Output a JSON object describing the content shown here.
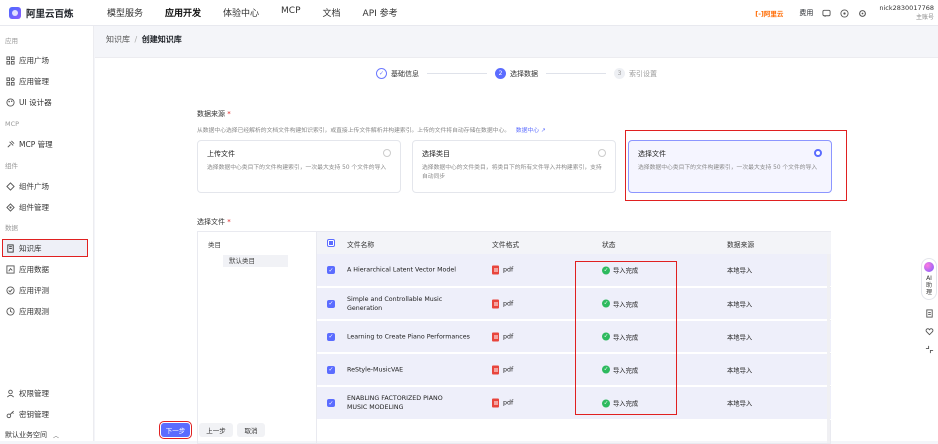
{
  "brand": {
    "name": "阿里云百炼"
  },
  "nav": [
    "模型服务",
    "应用开发",
    "体验中心",
    "MCP",
    "文档",
    "API 参考"
  ],
  "topright": {
    "badge": "[-]阿里云",
    "cost": "费用",
    "user_name": "nick2830017768",
    "user_sub": "主账号"
  },
  "sidebar": {
    "groups": [
      "应用",
      "MCP",
      "组件",
      "数据"
    ],
    "items": [
      "应用广场",
      "应用管理",
      "UI 设计器",
      "MCP 管理",
      "组件广场",
      "组件管理",
      "知识库",
      "应用数据",
      "应用评测",
      "应用观测",
      "权限管理",
      "密钥管理",
      "默认业务空间"
    ]
  },
  "breadcrumb": {
    "parent": "知识库",
    "sep": "/",
    "current": "创建知识库"
  },
  "steps": [
    {
      "num": "✓",
      "label": "基础信息"
    },
    {
      "num": "2",
      "label": "选择数据"
    },
    {
      "num": "3",
      "label": "索引设置"
    }
  ],
  "source": {
    "label": "数据来源",
    "required": "*",
    "hint": "从数据中心选择已经解析的文档文件构建知识索引，或直接上传文件解析并构建索引。上传的文件将自动存储在数据中心。",
    "link": "数据中心 ↗",
    "cards": [
      {
        "title": "上传文件",
        "desc": "选择数据中心类目下的文件构建索引，一次最大支持 50 个文件的导入"
      },
      {
        "title": "选择类目",
        "desc": "选择数据中心的文件类目，将类目下的所有文件导入并构建索引，支持自动同步"
      },
      {
        "title": "选择文件",
        "desc": "选择数据中心类目下的文件构建索引，一次最大支持 50 个文件的导入"
      }
    ]
  },
  "files": {
    "label": "选择文件",
    "required": "*",
    "category_head": "类目",
    "category_item": "默认类目",
    "columns": [
      "文件名称",
      "文件格式",
      "状态",
      "数据来源"
    ],
    "rows": [
      {
        "name": "A Hierarchical Latent Vector Model",
        "format": "pdf",
        "status": "导入完成",
        "source": "本地导入"
      },
      {
        "name": "Simple and Controllable Music Generation",
        "format": "pdf",
        "status": "导入完成",
        "source": "本地导入"
      },
      {
        "name": "Learning to Create Piano Performances",
        "format": "pdf",
        "status": "导入完成",
        "source": "本地导入"
      },
      {
        "name": "ReStyle-MusicVAE",
        "format": "pdf",
        "status": "导入完成",
        "source": "本地导入"
      },
      {
        "name": "ENABLING FACTORIZED PIANO MUSIC MODELING",
        "format": "pdf",
        "status": "导入完成",
        "source": "本地导入"
      }
    ]
  },
  "footer": {
    "next": "下一步",
    "prev": "上一步",
    "cancel": "取消"
  },
  "rail": {
    "ai": "AI",
    "ai2": "助",
    "ai3": "理"
  },
  "colors": {
    "accent": "#5b6cff",
    "highlight": "#e02020",
    "success": "#2dba5e"
  }
}
